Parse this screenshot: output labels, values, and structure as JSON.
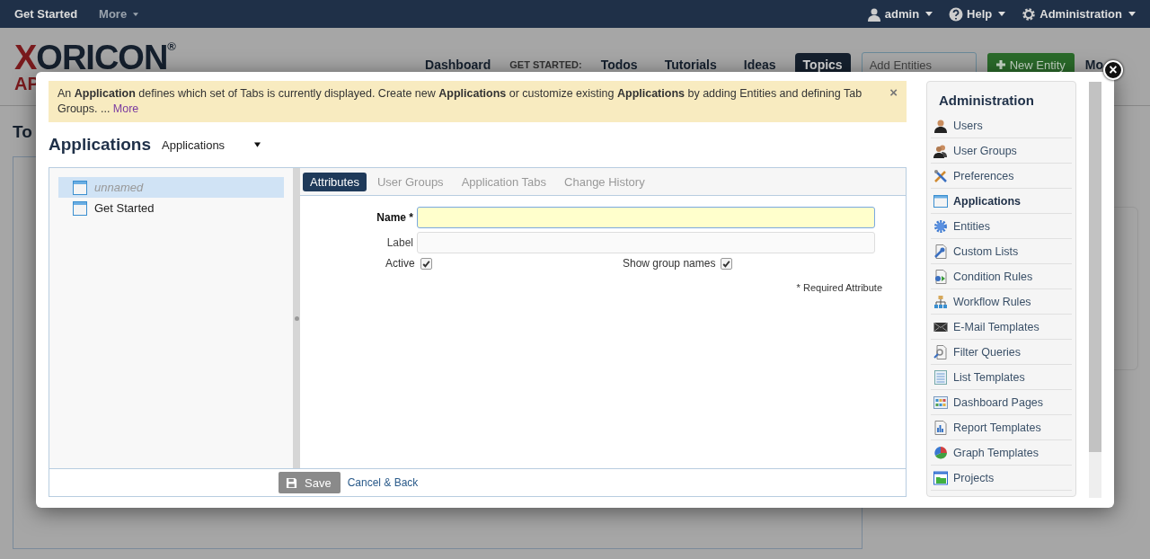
{
  "top_bar": {
    "left": [
      {
        "label": "Get Started",
        "caret": false
      },
      {
        "label": "More",
        "caret": true
      }
    ],
    "right": [
      {
        "label": "admin",
        "kind": "user"
      },
      {
        "label": "Help",
        "kind": "help"
      },
      {
        "label": "Administration",
        "kind": "settings"
      }
    ]
  },
  "header": {
    "logo": "XORICON",
    "logo_mark": "®",
    "logo_sub": "AP",
    "nav": [
      {
        "kind": "link",
        "label": "Dashboard",
        "selected": false
      },
      {
        "kind": "caption",
        "label": "GET STARTED:"
      },
      {
        "kind": "link",
        "label": "Todos",
        "selected": false
      },
      {
        "kind": "link",
        "label": "Tutorials",
        "selected": false
      },
      {
        "kind": "link",
        "label": "Ideas",
        "selected": false
      },
      {
        "kind": "link",
        "label": "Topics",
        "selected": true
      }
    ],
    "search": {
      "placeholder": "Add Entities"
    },
    "new_button": "New Entity",
    "more": "Mo"
  },
  "page_title": "To",
  "modal": {
    "close": "×",
    "notice": {
      "text": "An **Application** defines which set of Tabs is currently displayed. Create new **Applications** or customize existing **Applications** by adding Entities and defining Tab Groups. ...",
      "link": "More",
      "close": "×"
    },
    "title": "Applications",
    "selector": {
      "value": "Applications"
    },
    "tree": [
      {
        "label": "unnamed",
        "unnamed": true,
        "selected": true
      },
      {
        "label": "Get Started",
        "unnamed": false,
        "selected": false
      }
    ],
    "tabs": [
      {
        "label": "Attributes",
        "selected": true
      },
      {
        "label": "User Groups",
        "selected": false
      },
      {
        "label": "Application Tabs",
        "selected": false
      },
      {
        "label": "Change History",
        "selected": false
      }
    ],
    "fields": [
      {
        "label": "Name *",
        "required": true
      },
      {
        "label": "Label",
        "required": false
      }
    ],
    "checkboxes": [
      {
        "label": "Active",
        "checked": true
      },
      {
        "label": "Show group names",
        "checked": true
      }
    ],
    "required_note": "* Required Attribute",
    "save": "Save",
    "cancel": "Cancel & Back",
    "admin": {
      "title": "Administration",
      "items": [
        {
          "label": "Users",
          "kind": "user",
          "selected": false
        },
        {
          "label": "User Groups",
          "kind": "users",
          "selected": false
        },
        {
          "label": "Preferences",
          "kind": "tools",
          "selected": false
        },
        {
          "label": "Applications",
          "kind": "window",
          "selected": true
        },
        {
          "label": "Entities",
          "kind": "gear",
          "selected": false
        },
        {
          "label": "Custom Lists",
          "kind": "wrench",
          "selected": false
        },
        {
          "label": "Condition Rules",
          "kind": "rule",
          "selected": false
        },
        {
          "label": "Workflow Rules",
          "kind": "tree",
          "selected": false
        },
        {
          "label": "E-Mail Templates",
          "kind": "mail",
          "selected": false
        },
        {
          "label": "Filter Queries",
          "kind": "search",
          "selected": false
        },
        {
          "label": "List Templates",
          "kind": "list",
          "selected": false
        },
        {
          "label": "Dashboard Pages",
          "kind": "dashboard",
          "selected": false
        },
        {
          "label": "Report Templates",
          "kind": "report",
          "selected": false
        },
        {
          "label": "Graph Templates",
          "kind": "pie",
          "selected": false
        },
        {
          "label": "Projects",
          "kind": "folder",
          "selected": false
        }
      ]
    }
  }
}
